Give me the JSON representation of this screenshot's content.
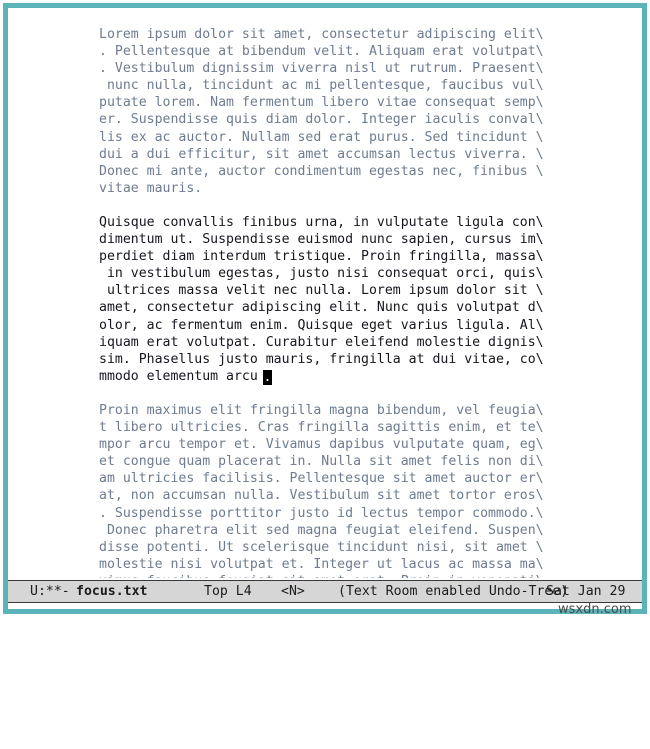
{
  "window": {
    "border_color": "#5cb3b8",
    "background": "#ffffff"
  },
  "buffer": {
    "dim_text_color": "#6e7c90",
    "focused_text_color": "#16161f",
    "cursor_color": "#000000",
    "cursor_char": ".",
    "paragraphs": [
      {
        "id": "paragraph-1",
        "focused": false,
        "text": "Lorem ipsum dolor sit amet, consectetur adipiscing elit\\\n. Pellentesque at bibendum velit. Aliquam erat volutpat\\\n. Vestibulum dignissim viverra nisl ut rutrum. Praesent\\\n nunc nulla, tincidunt ac mi pellentesque, faucibus vul\\\nputate lorem. Nam fermentum libero vitae consequat semp\\\ner. Suspendisse quis diam dolor. Integer iaculis conval\\\nlis ex ac auctor. Nullam sed erat purus. Sed tincidunt \\\ndui a dui efficitur, sit amet accumsan lectus viverra. \\\nDonec mi ante, auctor condimentum egestas nec, finibus \\\nvitae mauris."
      },
      {
        "id": "paragraph-2",
        "focused": true,
        "text": "Quisque convallis finibus urna, in vulputate ligula con\\\ndimentum ut. Suspendisse euismod nunc sapien, cursus im\\\nperdiet diam interdum tristique. Proin fringilla, massa\\\n in vestibulum egestas, justo nisi consequat orci, quis\\\n ultrices massa velit nec nulla. Lorem ipsum dolor sit \\\namet, consectetur adipiscing elit. Nunc quis volutpat d\\\nolor, ac fermentum enim. Quisque eget varius ligula. Al\\\niquam erat volutpat. Curabitur eleifend molestie dignis\\\nsim. Phasellus justo mauris, fringilla at dui vitae, co\\\nmmodo elementum arcu"
      },
      {
        "id": "paragraph-3",
        "focused": false,
        "text": "Proin maximus elit fringilla magna bibendum, vel feugia\\\nt libero ultricies. Cras fringilla sagittis enim, et te\\\nmpor arcu tempor et. Vivamus dapibus vulputate quam, eg\\\net congue quam placerat in. Nulla sit amet felis non di\\\nam ultricies facilisis. Pellentesque sit amet auctor er\\\nat, non accumsan nulla. Vestibulum sit amet tortor eros\\\n. Suspendisse porttitor justo id lectus tempor commodo.\\\n Donec pharetra elit sed magna feugiat eleifend. Suspen\\\ndisse potenti. Ut scelerisque tincidunt nisi, sit amet \\\nmolestie nisi volutpat et. Integer ut lacus ac massa ma\\\nximus faucibus feugiat sit amet erat. Proin in venenati\\"
      }
    ]
  },
  "mode_line": {
    "background": "#d6d6d6",
    "flags": "U:**-",
    "buffer_name": "focus.txt",
    "position": "Top L4",
    "narrow_indicator": "<N>",
    "minor_modes": "(Text Room enabled Undo-Tree)",
    "date": "Sat Jan 29"
  },
  "watermark": {
    "text": "wsxdn.com"
  }
}
